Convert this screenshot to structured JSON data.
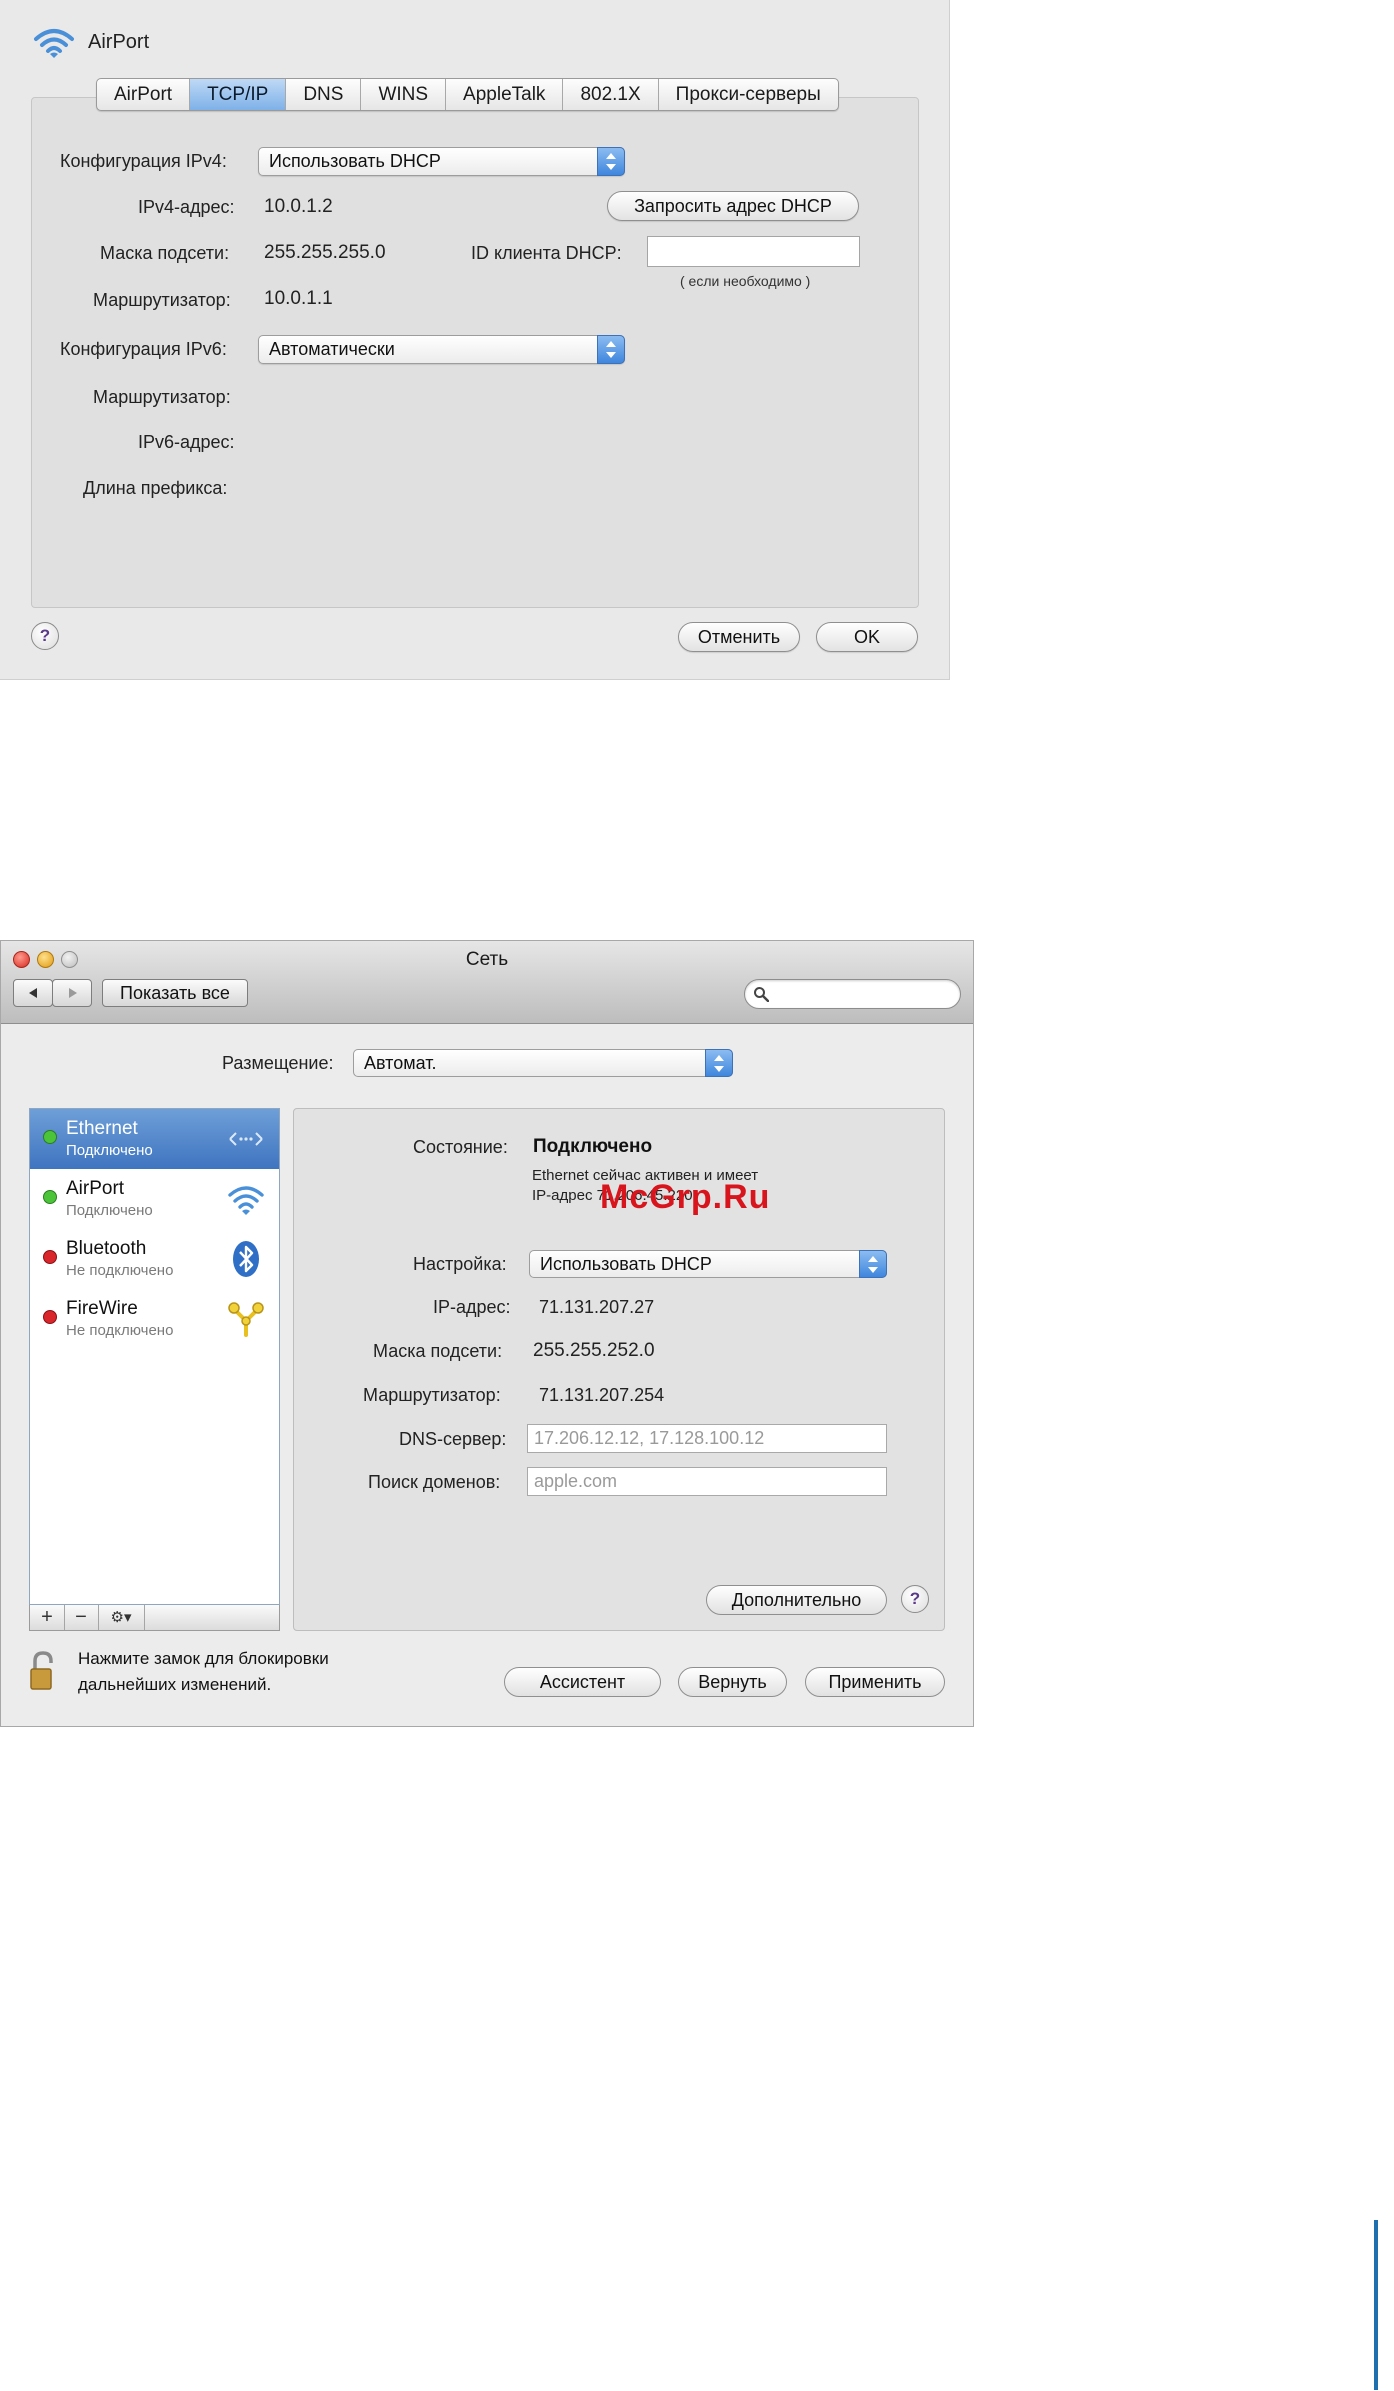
{
  "airport_sheet": {
    "title": "AirPort",
    "tabs": [
      "AirPort",
      "TCP/IP",
      "DNS",
      "WINS",
      "AppleTalk",
      "802.1X",
      "Прокси-серверы"
    ],
    "active_tab": "TCP/IP",
    "ipv4_config_label": "Конфигурация IPv4:",
    "ipv4_config_value": "Использовать DHCP",
    "ipv4_address_label": "IPv4-адрес:",
    "ipv4_address_value": "10.0.1.2",
    "subnet_label": "Маска подсети:",
    "subnet_value": "255.255.255.0",
    "router_label": "Маршрутизатор:",
    "router_value": "10.0.1.1",
    "renew_dhcp_button": "Запросить адрес DHCP",
    "dhcp_client_id_label": "ID клиента DHCP:",
    "dhcp_client_id_value": "",
    "dhcp_client_id_hint": "( если необходимо )",
    "ipv6_config_label": "Конфигурация IPv6:",
    "ipv6_config_value": "Автоматически",
    "ipv6_router_label": "Маршрутизатор:",
    "ipv6_address_label": "IPv6-адрес:",
    "prefix_length_label": "Длина префикса:",
    "help_glyph": "?",
    "cancel_button": "Отменить",
    "ok_button": "OK"
  },
  "network_window": {
    "title": "Сеть",
    "show_all_button": "Показать все",
    "search_placeholder": "",
    "location_label": "Размещение:",
    "location_value": "Автомат.",
    "services": [
      {
        "name": "Ethernet",
        "status": "Подключено",
        "status_color": "#4cc43a",
        "icon": "ethernet-icon",
        "selected": true
      },
      {
        "name": "AirPort",
        "status": "Подключено",
        "status_color": "#4cc43a",
        "icon": "wifi-icon",
        "selected": false
      },
      {
        "name": "Bluetooth",
        "status": "Не подключено",
        "status_color": "#d8262b",
        "icon": "bluetooth-icon",
        "selected": false
      },
      {
        "name": "FireWire",
        "status": "Не подключено",
        "status_color": "#d8262b",
        "icon": "firewire-icon",
        "selected": false
      }
    ],
    "list_add": "+",
    "list_remove": "−",
    "list_action": "⚙▾",
    "status_label": "Состояние:",
    "status_value": "Подключено",
    "status_desc_line1": "Ethernet сейчас активен и имеет",
    "status_desc_line2": "IP-адрес 71.206.45.220.",
    "config_label": "Настройка:",
    "config_value": "Использовать DHCP",
    "ip_label": "IP-адрес:",
    "ip_value": "71.131.207.27",
    "subnet_label": "Маска подсети:",
    "subnet_value": "255.255.252.0",
    "router_label": "Маршрутизатор:",
    "router_value": "71.131.207.254",
    "dns_label": "DNS-сервер:",
    "dns_value": "17.206.12.12, 17.128.100.12",
    "search_domains_label": "Поиск доменов:",
    "search_domains_value": "apple.com",
    "advanced_button": "Дополнительно",
    "help_glyph": "?",
    "lock_line1": "Нажмите замок для блокировки",
    "lock_line2": "дальнейших изменений.",
    "assistant_button": "Ассистент",
    "revert_button": "Вернуть",
    "apply_button": "Применить"
  },
  "watermark": "McGrp.Ru"
}
